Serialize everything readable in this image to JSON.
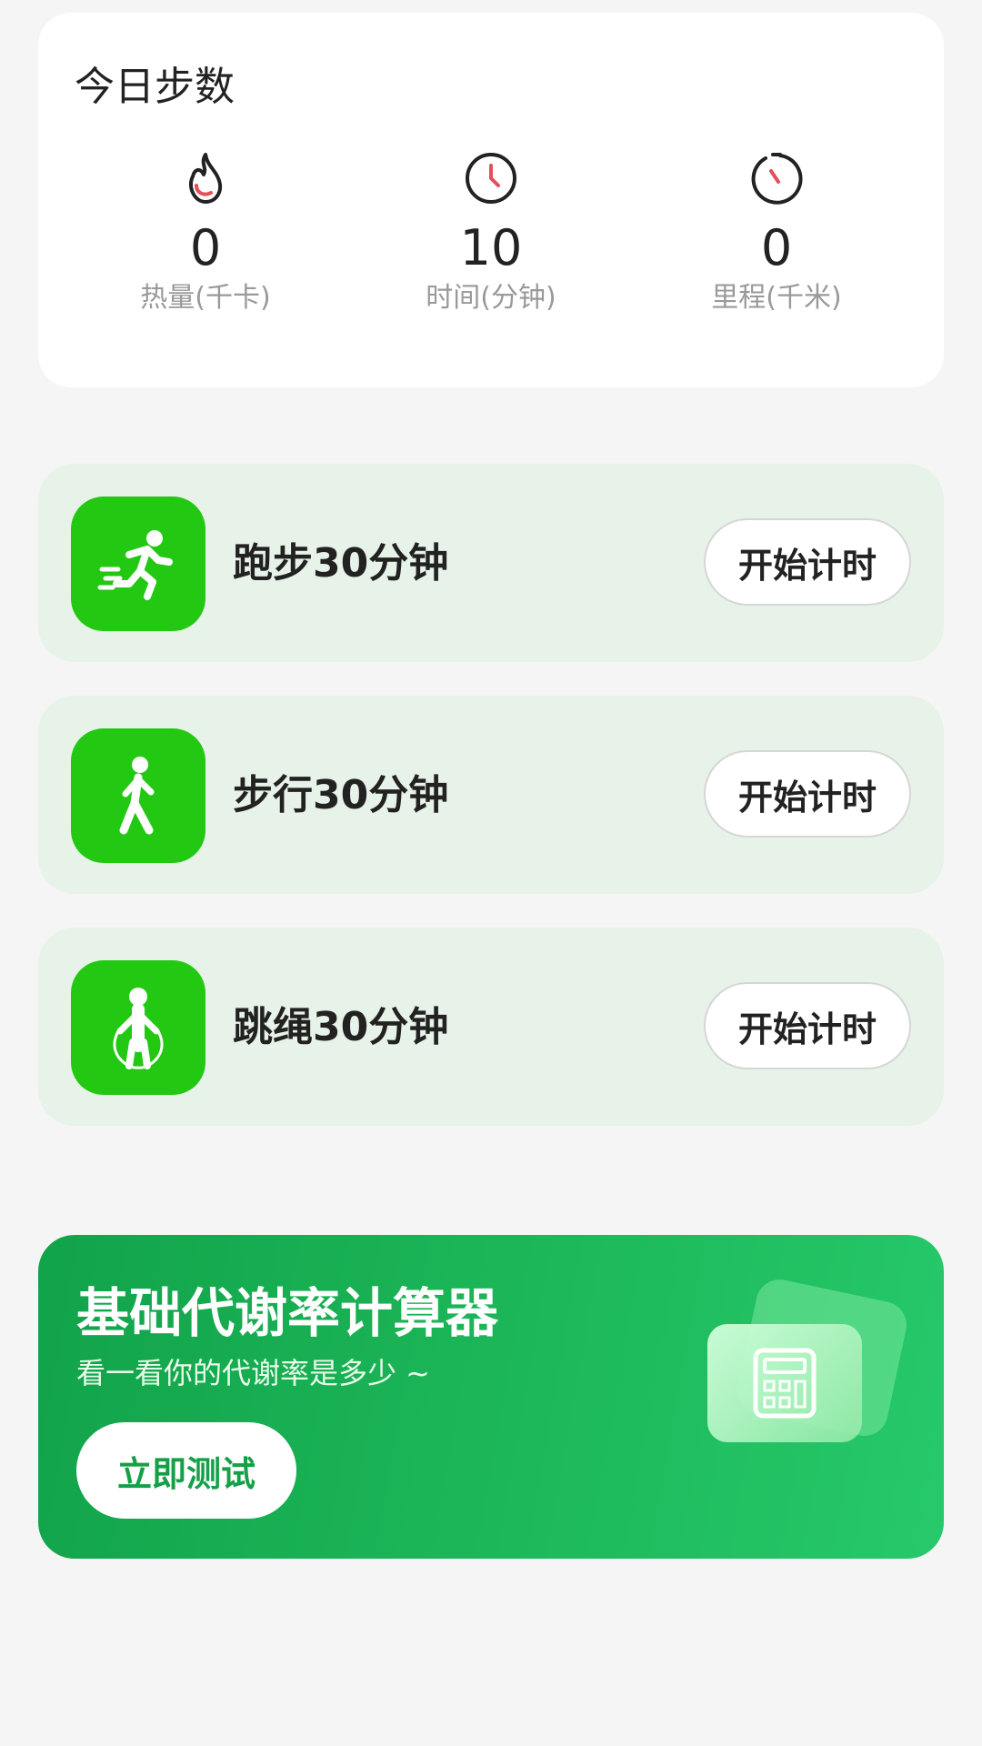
{
  "stats": {
    "title": "今日步数",
    "items": [
      {
        "value": "0",
        "label": "热量(千卡)",
        "icon": "flame-icon"
      },
      {
        "value": "10",
        "label": "时间(分钟)",
        "icon": "clock-icon"
      },
      {
        "value": "0",
        "label": "里程(千米)",
        "icon": "stopwatch-icon"
      }
    ]
  },
  "activities": [
    {
      "label": "跑步30分钟",
      "button": "开始计时",
      "icon": "running-icon"
    },
    {
      "label": "步行30分钟",
      "button": "开始计时",
      "icon": "walking-icon"
    },
    {
      "label": "跳绳30分钟",
      "button": "开始计时",
      "icon": "jump-rope-icon"
    }
  ],
  "banner": {
    "title": "基础代谢率计算器",
    "subtitle": "看一看你的代谢率是多少 ~",
    "button": "立即测试",
    "icon": "calculator-icon"
  },
  "colors": {
    "accent_green": "#23c813",
    "banner_green": "#1db85a",
    "activity_bg": "#e7f2e8",
    "icon_red": "#e4505a"
  }
}
